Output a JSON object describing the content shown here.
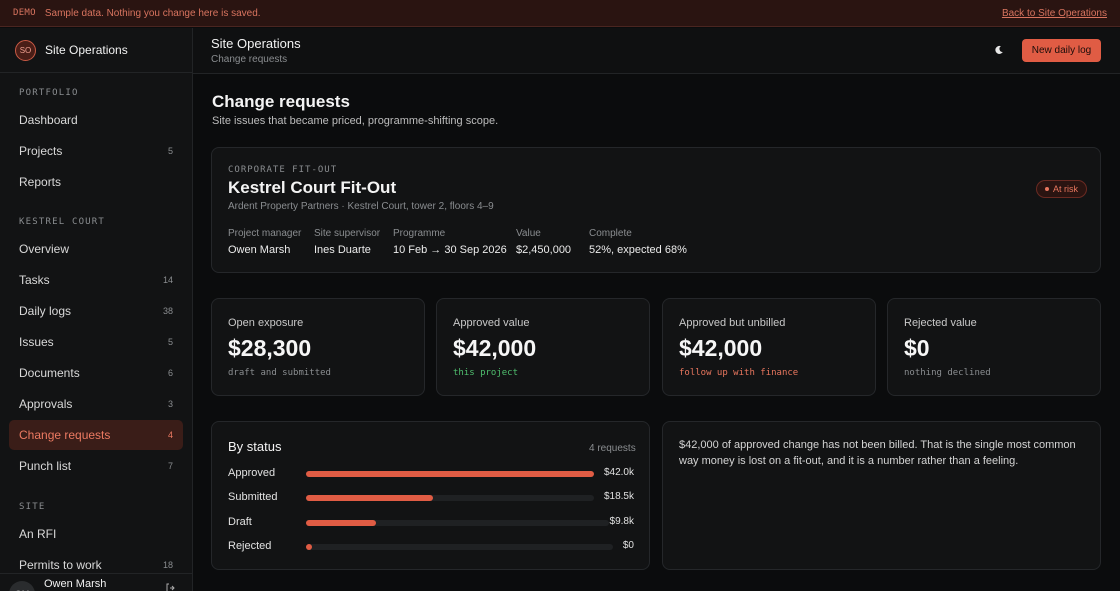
{
  "banner": {
    "tag": "DEMO",
    "message": "Sample data. Nothing you change here is saved.",
    "back_link": "Back to Site Operations"
  },
  "brand": {
    "initials": "SO",
    "name": "Site Operations"
  },
  "sidebar": {
    "sections": [
      {
        "title": "PORTFOLIO",
        "items": [
          {
            "label": "Dashboard",
            "count": ""
          },
          {
            "label": "Projects",
            "count": "5"
          },
          {
            "label": "Reports",
            "count": ""
          }
        ]
      },
      {
        "title": "KESTREL COURT",
        "items": [
          {
            "label": "Overview",
            "count": ""
          },
          {
            "label": "Tasks",
            "count": "14"
          },
          {
            "label": "Daily logs",
            "count": "38"
          },
          {
            "label": "Issues",
            "count": "5"
          },
          {
            "label": "Documents",
            "count": "6"
          },
          {
            "label": "Approvals",
            "count": "3"
          },
          {
            "label": "Change requests",
            "count": "4",
            "active": true
          },
          {
            "label": "Punch list",
            "count": "7"
          }
        ]
      },
      {
        "title": "SITE",
        "items": [
          {
            "label": "An RFI",
            "count": ""
          },
          {
            "label": "Permits to work",
            "count": "18"
          }
        ]
      }
    ]
  },
  "user": {
    "initials": "OM",
    "name": "Owen Marsh",
    "icon": "exit-icon"
  },
  "header": {
    "title": "Site Operations",
    "breadcrumb": "Change requests",
    "theme_icon": "moon-icon",
    "cta": "New daily log"
  },
  "page": {
    "title": "Change requests",
    "subtitle": "Site issues that became priced, programme-shifting scope."
  },
  "project": {
    "kicker": "CORPORATE FIT-OUT",
    "name": "Kestrel Court Fit-Out",
    "client": "Ardent Property Partners · Kestrel Court, tower 2, floors 4–9",
    "status": "At risk",
    "status_color": "#e8765e",
    "meta": [
      {
        "label": "Project manager",
        "value": "Owen Marsh"
      },
      {
        "label": "Site supervisor",
        "value": "Ines Duarte"
      },
      {
        "label": "Programme",
        "value": "10 Feb → 30 Sep 2026"
      },
      {
        "label": "Value",
        "value": "$2,450,000"
      },
      {
        "label": "Complete",
        "value": "52%, expected 68%"
      }
    ]
  },
  "stats": [
    {
      "label": "Open exposure",
      "value": "$28,300",
      "note": "draft and submitted",
      "tone": "muted"
    },
    {
      "label": "Approved value",
      "value": "$42,000",
      "note": "this project",
      "tone": "green"
    },
    {
      "label": "Approved but unbilled",
      "value": "$42,000",
      "note": "follow up with finance",
      "tone": "red"
    },
    {
      "label": "Rejected value",
      "value": "$0",
      "note": "nothing declined",
      "tone": "muted"
    }
  ],
  "by_status": {
    "title": "By status",
    "count": "4 requests",
    "rows": [
      {
        "label": "Approved",
        "amount": "$42.0k",
        "fraction": 1.0
      },
      {
        "label": "Submitted",
        "amount": "$18.5k",
        "fraction": 0.44
      },
      {
        "label": "Draft",
        "amount": "$9.8k",
        "fraction": 0.23
      },
      {
        "label": "Rejected",
        "amount": "$0",
        "fraction": 0.0
      }
    ]
  },
  "note": {
    "text": "$42,000 of approved change has not been billed. That is the single most common way money is lost on a fit-out, and it is a number rather than a feeling."
  },
  "colors": {
    "accent": "#e05c44",
    "positive": "#4fbf6e",
    "background": "#0b0c0d"
  }
}
